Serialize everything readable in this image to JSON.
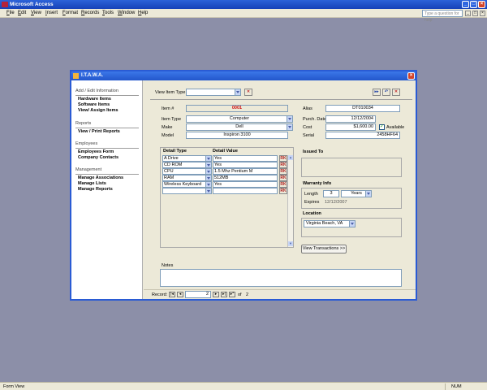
{
  "app": {
    "title": "Microsoft Access",
    "ask_placeholder": "Type a question for help"
  },
  "menu": [
    "File",
    "Edit",
    "View",
    "Insert",
    "Format",
    "Records",
    "Tools",
    "Window",
    "Help"
  ],
  "status": {
    "left": "Form View",
    "right": "NUM"
  },
  "form": {
    "title": "I.T.A.W.A.",
    "sidebar": {
      "sections": [
        {
          "heading": "Add / Edit Information",
          "links": [
            "Hardware Items",
            "Software Items",
            "View/ Assign Items"
          ]
        },
        {
          "heading": "Reports",
          "links": [
            "View / Print Reports"
          ]
        },
        {
          "heading": "Employees",
          "links": [
            "Employees Form",
            "Company Contacts"
          ]
        },
        {
          "heading": "Management",
          "links": [
            "Manage Associations",
            "Manage Lists",
            "Manage Reports"
          ]
        }
      ]
    },
    "toolbar": {
      "view_item_type_label": "View Item Type",
      "view_item_type_value": ""
    },
    "item": {
      "item_no_label": "Item #",
      "item_no": "0001",
      "item_type_label": "Item Type",
      "item_type": "Computer",
      "make_label": "Make",
      "make": "Dell",
      "model_label": "Model",
      "model": "Inspiron 3100",
      "alias_label": "Alias",
      "alias": "DT010034",
      "purch_date_label": "Purch. Date",
      "purch_date": "12/12/2004",
      "cost_label": "Cost",
      "cost": "$1,600.00",
      "available_label": "Available",
      "available": true,
      "serial_label": "Serial",
      "serial": "2458HF64"
    },
    "details": {
      "type_header": "Detail Type",
      "value_header": "Detail Value",
      "rows": [
        {
          "type": "A Drive",
          "value": "Yes"
        },
        {
          "type": "CD ROM",
          "value": "Yes"
        },
        {
          "type": "CPU",
          "value": "1.5 Mhz Pentium M"
        },
        {
          "type": "RAM",
          "value": "512MB"
        },
        {
          "type": "Wireless Keyboard",
          "value": "Yes"
        },
        {
          "type": "",
          "value": ""
        }
      ]
    },
    "issued_to": {
      "label": "Issued To",
      "value": ""
    },
    "warranty": {
      "heading": "Warranty Info",
      "length_label": "Length",
      "length_value": "3",
      "length_unit": "Years",
      "expires_label": "Expires",
      "expires": "12/12/2007"
    },
    "location": {
      "label": "Location",
      "value": "Virginia Beach, VA"
    },
    "view_transactions": "View Transactions >>",
    "notes": {
      "label": "Notes",
      "value": ""
    },
    "record_nav": {
      "label": "Record:",
      "current": "2",
      "of_label": "of",
      "total": "2"
    }
  }
}
